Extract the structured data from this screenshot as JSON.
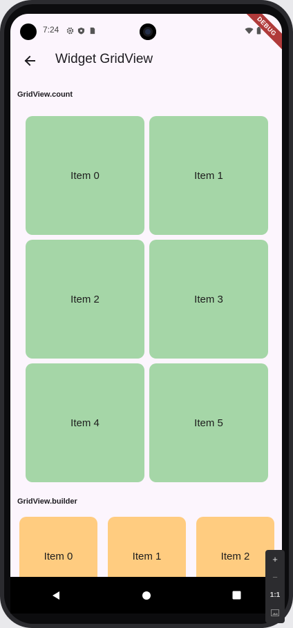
{
  "status_bar": {
    "time": "7:24",
    "icons": [
      "gear-icon",
      "shield-icon",
      "sim-card-icon"
    ],
    "right_icons": [
      "wifi-icon",
      "battery-icon"
    ],
    "debug_banner": "DEBUG"
  },
  "app_bar": {
    "title": "Widget GridView",
    "back_icon": "arrow-back-icon"
  },
  "section_count": {
    "title": "GridView.count",
    "color": "#a5d6a7",
    "items": [
      "Item 0",
      "Item 1",
      "Item 2",
      "Item 3",
      "Item 4",
      "Item 5"
    ]
  },
  "section_builder": {
    "title": "GridView.builder",
    "color": "#ffcc80",
    "items": [
      "Item 0",
      "Item 1",
      "Item 2"
    ]
  },
  "nav_bar": {
    "buttons": [
      "back-triangle-icon",
      "home-circle-icon",
      "recents-square-icon"
    ]
  },
  "zoom_panel": {
    "zoom_in": "+",
    "zoom_out": "−",
    "ratio": "1:1"
  }
}
